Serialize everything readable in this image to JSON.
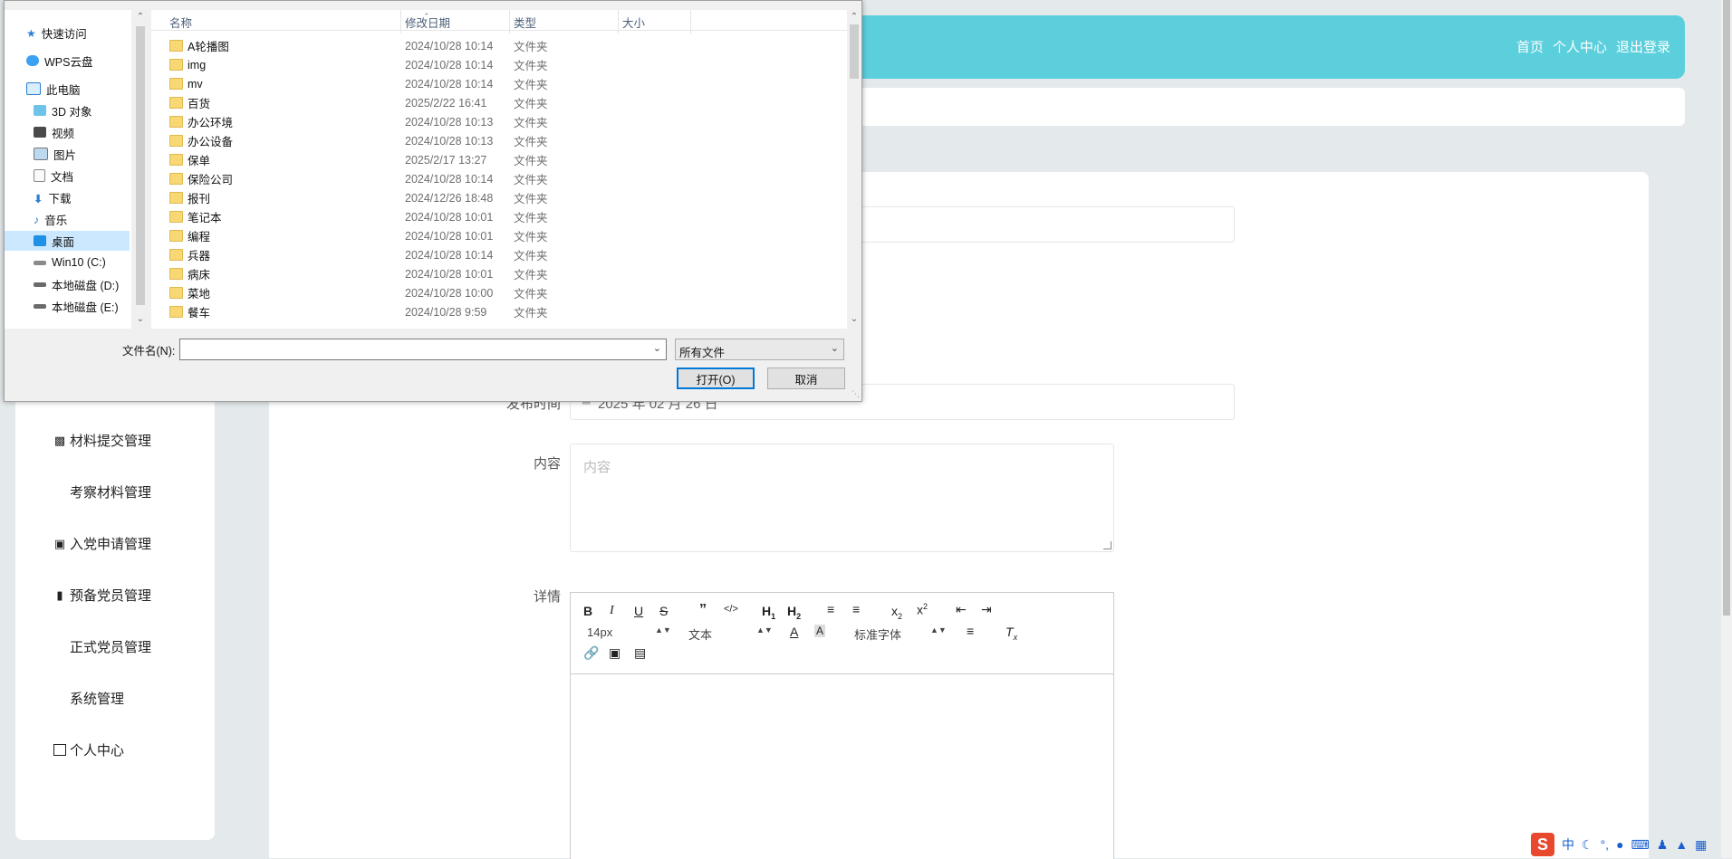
{
  "app": {
    "topnav": [
      "首页",
      "个人中心",
      "退出登录"
    ],
    "sidebar": [
      "材料提交管理",
      "考察材料管理",
      "入党申请管理",
      "预备党员管理",
      "正式党员管理",
      "系统管理",
      "个人中心"
    ],
    "form": {
      "publish_label": "发布时间",
      "publish_value": "2025 年 02 月 26 日",
      "content_label": "内容",
      "content_placeholder": "内容",
      "detail_label": "详情"
    },
    "editor": {
      "font_size": "14px",
      "block_type": "文本",
      "font_family": "标准字体"
    }
  },
  "dialog": {
    "nav": [
      {
        "label": "快速访问",
        "icon": "star-icon"
      },
      {
        "label": "WPS云盘",
        "icon": "cloud-icon"
      },
      {
        "label": "此电脑",
        "icon": "computer-icon"
      },
      {
        "label": "3D 对象",
        "icon": "cube-icon"
      },
      {
        "label": "视频",
        "icon": "video-icon"
      },
      {
        "label": "图片",
        "icon": "picture-icon"
      },
      {
        "label": "文档",
        "icon": "document-icon"
      },
      {
        "label": "下载",
        "icon": "download-icon"
      },
      {
        "label": "音乐",
        "icon": "music-icon"
      },
      {
        "label": "桌面",
        "icon": "desktop-icon"
      },
      {
        "label": "Win10 (C:)",
        "icon": "drive-icon"
      },
      {
        "label": "本地磁盘 (D:)",
        "icon": "drive-icon"
      },
      {
        "label": "本地磁盘 (E:)",
        "icon": "drive-icon"
      }
    ],
    "columns": {
      "name": "名称",
      "date": "修改日期",
      "type": "类型",
      "size": "大小"
    },
    "files": [
      {
        "name": "A轮播图",
        "date": "2024/10/28 10:14",
        "type": "文件夹"
      },
      {
        "name": "img",
        "date": "2024/10/28 10:14",
        "type": "文件夹"
      },
      {
        "name": "mv",
        "date": "2024/10/28 10:14",
        "type": "文件夹"
      },
      {
        "name": "百货",
        "date": "2025/2/22 16:41",
        "type": "文件夹"
      },
      {
        "name": "办公环境",
        "date": "2024/10/28 10:13",
        "type": "文件夹"
      },
      {
        "name": "办公设备",
        "date": "2024/10/28 10:13",
        "type": "文件夹"
      },
      {
        "name": "保单",
        "date": "2025/2/17 13:27",
        "type": "文件夹"
      },
      {
        "name": "保险公司",
        "date": "2024/10/28 10:14",
        "type": "文件夹"
      },
      {
        "name": "报刊",
        "date": "2024/12/26 18:48",
        "type": "文件夹"
      },
      {
        "name": "笔记本",
        "date": "2024/10/28 10:01",
        "type": "文件夹"
      },
      {
        "name": "编程",
        "date": "2024/10/28 10:01",
        "type": "文件夹"
      },
      {
        "name": "兵器",
        "date": "2024/10/28 10:14",
        "type": "文件夹"
      },
      {
        "name": "病床",
        "date": "2024/10/28 10:01",
        "type": "文件夹"
      },
      {
        "name": "菜地",
        "date": "2024/10/28 10:00",
        "type": "文件夹"
      },
      {
        "name": "餐车",
        "date": "2024/10/28 9:59",
        "type": "文件夹"
      }
    ],
    "filename_label": "文件名(N):",
    "filename_value": "",
    "filetype_value": "所有文件",
    "open_label": "打开(O)",
    "cancel_label": "取消"
  },
  "tray": {
    "ime": "中"
  }
}
